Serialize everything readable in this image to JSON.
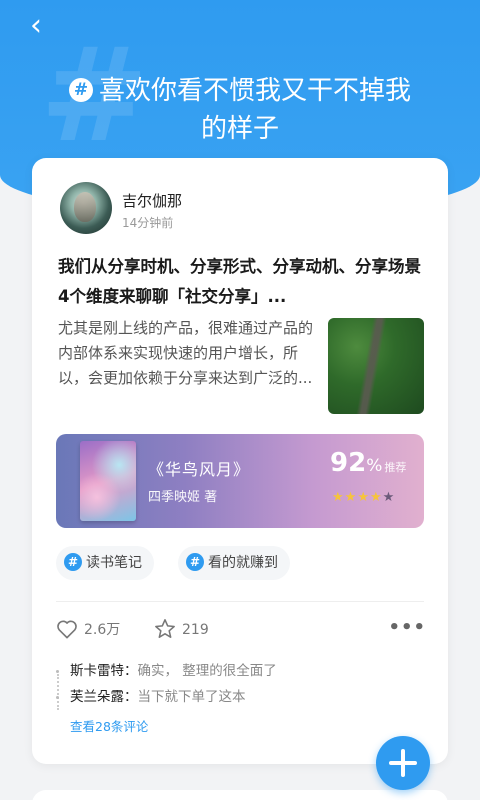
{
  "header": {
    "back_icon": "chevron-left-icon",
    "topic_hash": "#",
    "topic_title": "喜欢你看不惯我又干不掉我的样子"
  },
  "post": {
    "author": "吉尔伽那",
    "time": "14分钟前",
    "title": "我们从分享时机、分享形式、分享动机、分享场景4个维度来聊聊「社交分享」...",
    "excerpt": "尤其是刚上线的产品，很难通过产品的内部体系来实现快速的用户增长，所以，会更加依赖于分享来达到广泛的...",
    "book": {
      "title": "《华鸟风月》",
      "author": "四季映姬 著",
      "score": "92",
      "score_unit": "%",
      "score_label": "推荐",
      "stars": 4,
      "stars_total": 5
    },
    "tags": [
      {
        "hash": "#",
        "label": "读书笔记"
      },
      {
        "hash": "#",
        "label": "看的就赚到"
      }
    ],
    "likes": "2.6万",
    "favorites": "219",
    "comments": [
      {
        "user": "斯卡雷特：",
        "text": "确实， 整理的很全面了"
      },
      {
        "user": "芙兰朵露：",
        "text": "当下就下单了这本"
      }
    ],
    "view_comments": "查看28条评论"
  },
  "colors": {
    "accent": "#2f9bf0",
    "star": "#f6c43a"
  }
}
